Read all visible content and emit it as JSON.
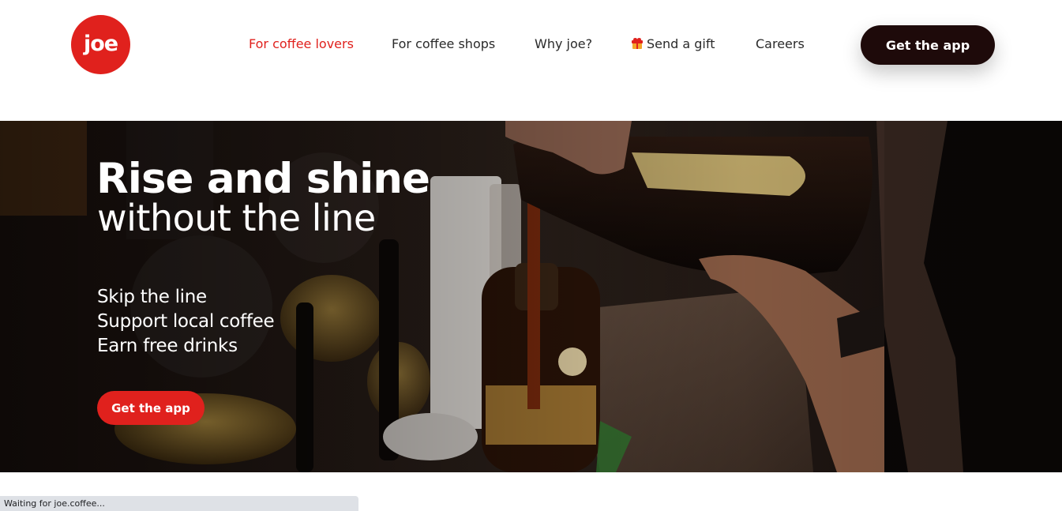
{
  "header": {
    "logo_text": "joe",
    "nav": [
      {
        "label": "For coffee lovers",
        "active": true
      },
      {
        "label": "For coffee shops",
        "active": false
      },
      {
        "label": "Why joe?",
        "active": false
      },
      {
        "label": "Send a gift",
        "active": false,
        "icon": "gift-icon"
      },
      {
        "label": "Careers",
        "active": false
      }
    ],
    "cta_label": "Get the app"
  },
  "hero": {
    "title": "Rise and shine",
    "subtitle": "without the line",
    "benefits": [
      "Skip the line",
      "Support local coffee",
      "Earn free drinks"
    ],
    "cta_label": "Get the app"
  },
  "status_bar": {
    "text": "Waiting for joe.coffee..."
  },
  "colors": {
    "brand_red": "#e0211d",
    "dark_button": "#1e0a0a"
  }
}
